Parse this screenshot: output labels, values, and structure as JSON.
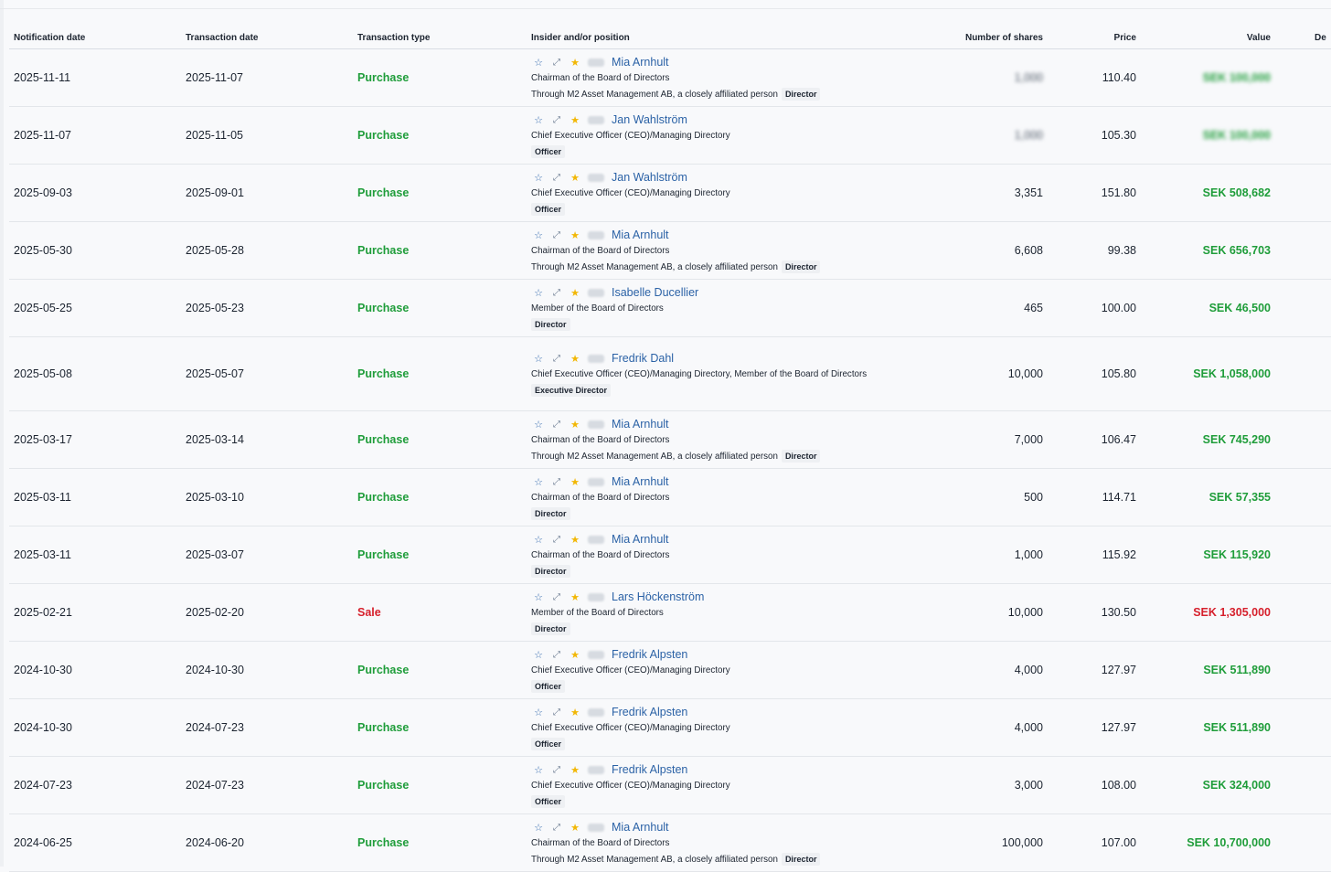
{
  "headers": {
    "notification_date": "Notification date",
    "transaction_date": "Transaction date",
    "transaction_type": "Transaction type",
    "insider": "Insider and/or position",
    "shares": "Number of shares",
    "price": "Price",
    "value": "Value",
    "extra": "De"
  },
  "rows": [
    {
      "notif": "2025-11-11",
      "trans": "2025-11-07",
      "type": "Purchase",
      "name": "Mia Arnhult",
      "position": "Chairman of the Board of Directors",
      "affiliation": "Through M2 Asset Management AB, a closely affiliated person",
      "badge": "Director",
      "shares": "1,000",
      "price": "110.40",
      "value": "SEK 100,000"
    },
    {
      "notif": "2025-11-07",
      "trans": "2025-11-05",
      "type": "Purchase",
      "name": "Jan Wahlström",
      "position": "Chief Executive Officer (CEO)/Managing Directory",
      "affiliation": "",
      "badge": "Officer",
      "shares": "1,000",
      "price": "105.30",
      "value": "SEK 100,000"
    },
    {
      "notif": "2025-09-03",
      "trans": "2025-09-01",
      "type": "Purchase",
      "name": "Jan Wahlström",
      "position": "Chief Executive Officer (CEO)/Managing Directory",
      "affiliation": "",
      "badge": "Officer",
      "shares": "3,351",
      "price": "151.80",
      "value": "SEK 508,682"
    },
    {
      "notif": "2025-05-30",
      "trans": "2025-05-28",
      "type": "Purchase",
      "name": "Mia Arnhult",
      "position": "Chairman of the Board of Directors",
      "affiliation": "Through M2 Asset Management AB, a closely affiliated person",
      "badge": "Director",
      "shares": "6,608",
      "price": "99.38",
      "value": "SEK 656,703"
    },
    {
      "notif": "2025-05-25",
      "trans": "2025-05-23",
      "type": "Purchase",
      "name": "Isabelle Ducellier",
      "position": "Member of the Board of Directors",
      "affiliation": "",
      "badge": "Director",
      "shares": "465",
      "price": "100.00",
      "value": "SEK 46,500"
    },
    {
      "notif": "2025-05-08",
      "trans": "2025-05-07",
      "type": "Purchase",
      "name": "Fredrik Dahl",
      "position": "Chief Executive Officer (CEO)/Managing Directory, Member of the Board of Directors",
      "affiliation": "",
      "badge": "Executive Director",
      "shares": "10,000",
      "price": "105.80",
      "value": "SEK 1,058,000"
    },
    {
      "notif": "2025-03-17",
      "trans": "2025-03-14",
      "type": "Purchase",
      "name": "Mia Arnhult",
      "position": "Chairman of the Board of Directors",
      "affiliation": "Through M2 Asset Management AB, a closely affiliated person",
      "badge": "Director",
      "shares": "7,000",
      "price": "106.47",
      "value": "SEK 745,290"
    },
    {
      "notif": "2025-03-11",
      "trans": "2025-03-10",
      "type": "Purchase",
      "name": "Mia Arnhult",
      "position": "Chairman of the Board of Directors",
      "affiliation": "",
      "badge": "Director",
      "shares": "500",
      "price": "114.71",
      "value": "SEK 57,355"
    },
    {
      "notif": "2025-03-11",
      "trans": "2025-03-07",
      "type": "Purchase",
      "name": "Mia Arnhult",
      "position": "Chairman of the Board of Directors",
      "affiliation": "",
      "badge": "Director",
      "shares": "1,000",
      "price": "115.92",
      "value": "SEK 115,920"
    },
    {
      "notif": "2025-02-21",
      "trans": "2025-02-20",
      "type": "Sale",
      "name": "Lars Höckenström",
      "position": "Member of the Board of Directors",
      "affiliation": "",
      "badge": "Director",
      "shares": "10,000",
      "price": "130.50",
      "value": "SEK 1,305,000"
    },
    {
      "notif": "2024-10-30",
      "trans": "2024-10-30",
      "type": "Purchase",
      "name": "Fredrik Alpsten",
      "position": "Chief Executive Officer (CEO)/Managing Directory",
      "affiliation": "",
      "badge": "Officer",
      "shares": "4,000",
      "price": "127.97",
      "value": "SEK 511,890"
    },
    {
      "notif": "2024-10-30",
      "trans": "2024-07-23",
      "type": "Purchase",
      "name": "Fredrik Alpsten",
      "position": "Chief Executive Officer (CEO)/Managing Directory",
      "affiliation": "",
      "badge": "Officer",
      "shares": "4,000",
      "price": "127.97",
      "value": "SEK 511,890"
    },
    {
      "notif": "2024-07-23",
      "trans": "2024-07-23",
      "type": "Purchase",
      "name": "Fredrik Alpsten",
      "position": "Chief Executive Officer (CEO)/Managing Directory",
      "affiliation": "",
      "badge": "Officer",
      "shares": "3,000",
      "price": "108.00",
      "value": "SEK 324,000"
    },
    {
      "notif": "2024-06-25",
      "trans": "2024-06-20",
      "type": "Purchase",
      "name": "Mia Arnhult",
      "position": "Chairman of the Board of Directors",
      "affiliation": "Through M2 Asset Management AB, a closely affiliated person",
      "badge": "Director",
      "shares": "100,000",
      "price": "107.00",
      "value": "SEK 10,700,000"
    }
  ],
  "colors": {
    "purchase": "#1f9d3a",
    "sale": "#d6202c",
    "link": "#2b62a6",
    "star": "#f2b705"
  },
  "icons": {
    "watch": "star-outline-icon",
    "expand": "expand-icon",
    "favorite": "star-filled-icon"
  }
}
